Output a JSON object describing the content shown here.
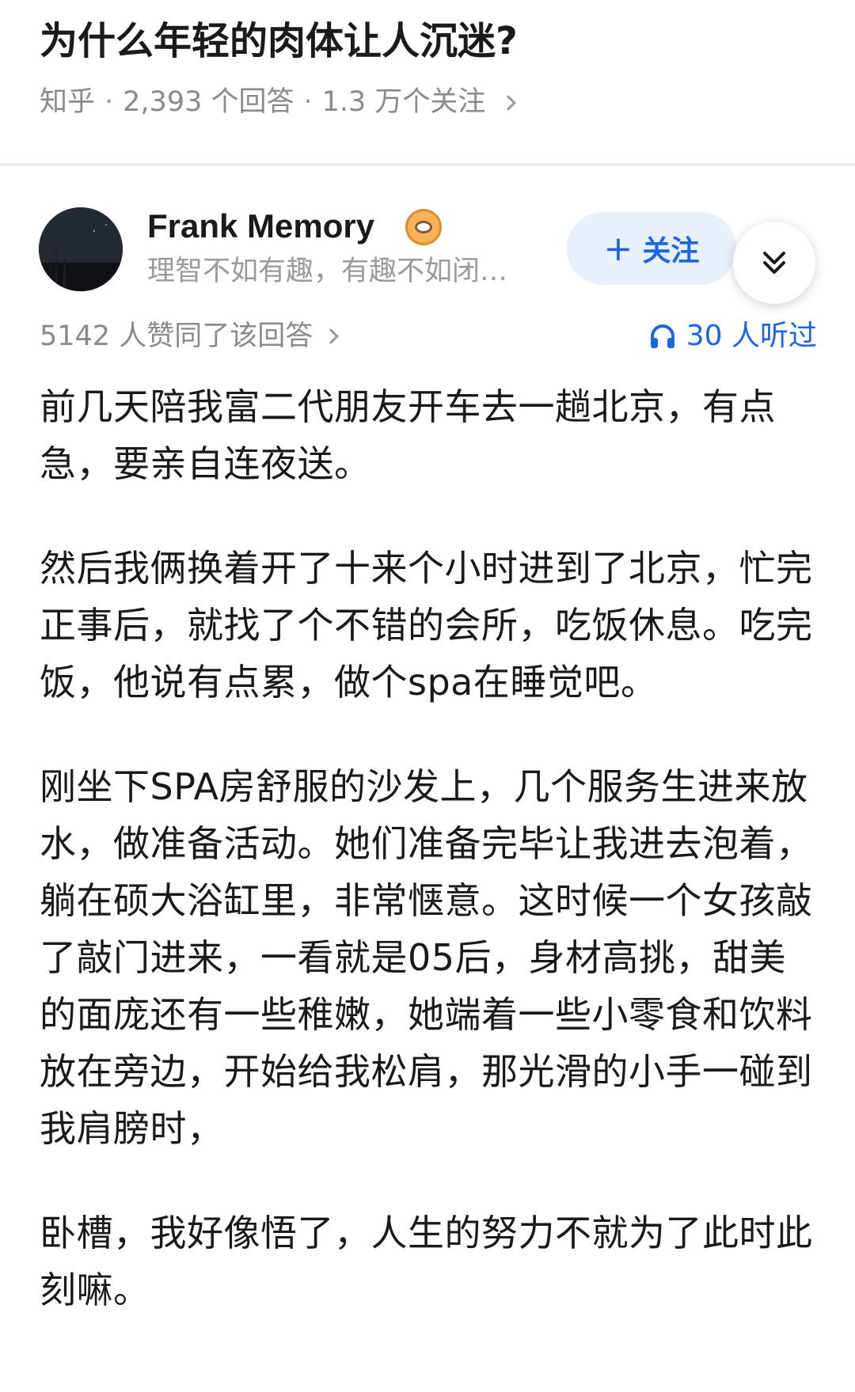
{
  "question": {
    "title": "为什么年轻的肉体让人沉迷?",
    "source": "知乎",
    "separator": "·",
    "answers": "2,393 个回答",
    "followers": "1.3 万个关注"
  },
  "author": {
    "name": "Frank Memory",
    "bio": "理智不如有趣，有趣不如闭…",
    "follow_label": "关注",
    "follow_icon": "plus-icon",
    "badge_icon": "eye-badge-icon"
  },
  "stats": {
    "upvotes": "5142 人赞同了该回答",
    "listens": "30 人听过",
    "listen_icon": "headphones-icon"
  },
  "answer": {
    "paragraphs": [
      "前几天陪我富二代朋友开车去一趟北京，有点急，要亲自连夜送。",
      "然后我俩换着开了十来个小时进到了北京，忙完正事后，就找了个不错的会所，吃饭休息。吃完饭，他说有点累，做个spa在睡觉吧。",
      "刚坐下SPA房舒服的沙发上，几个服务生进来放水，做准备活动。她们准备完毕让我进去泡着，躺在硕大浴缸里，非常惬意。这时候一个女孩敲了敲门进来，一看就是05后，身材高挑，甜美的面庞还有一些稚嫩，她端着一些小零食和饮料放在旁边，开始给我松肩，那光滑的小手一碰到我肩膀时，",
      "卧槽，我好像悟了，人生的努力不就为了此时此刻嘛。"
    ]
  },
  "colors": {
    "accent": "#1a66e0",
    "follow_bg": "#e8f0fc",
    "meta_text": "#8a8a8a"
  }
}
